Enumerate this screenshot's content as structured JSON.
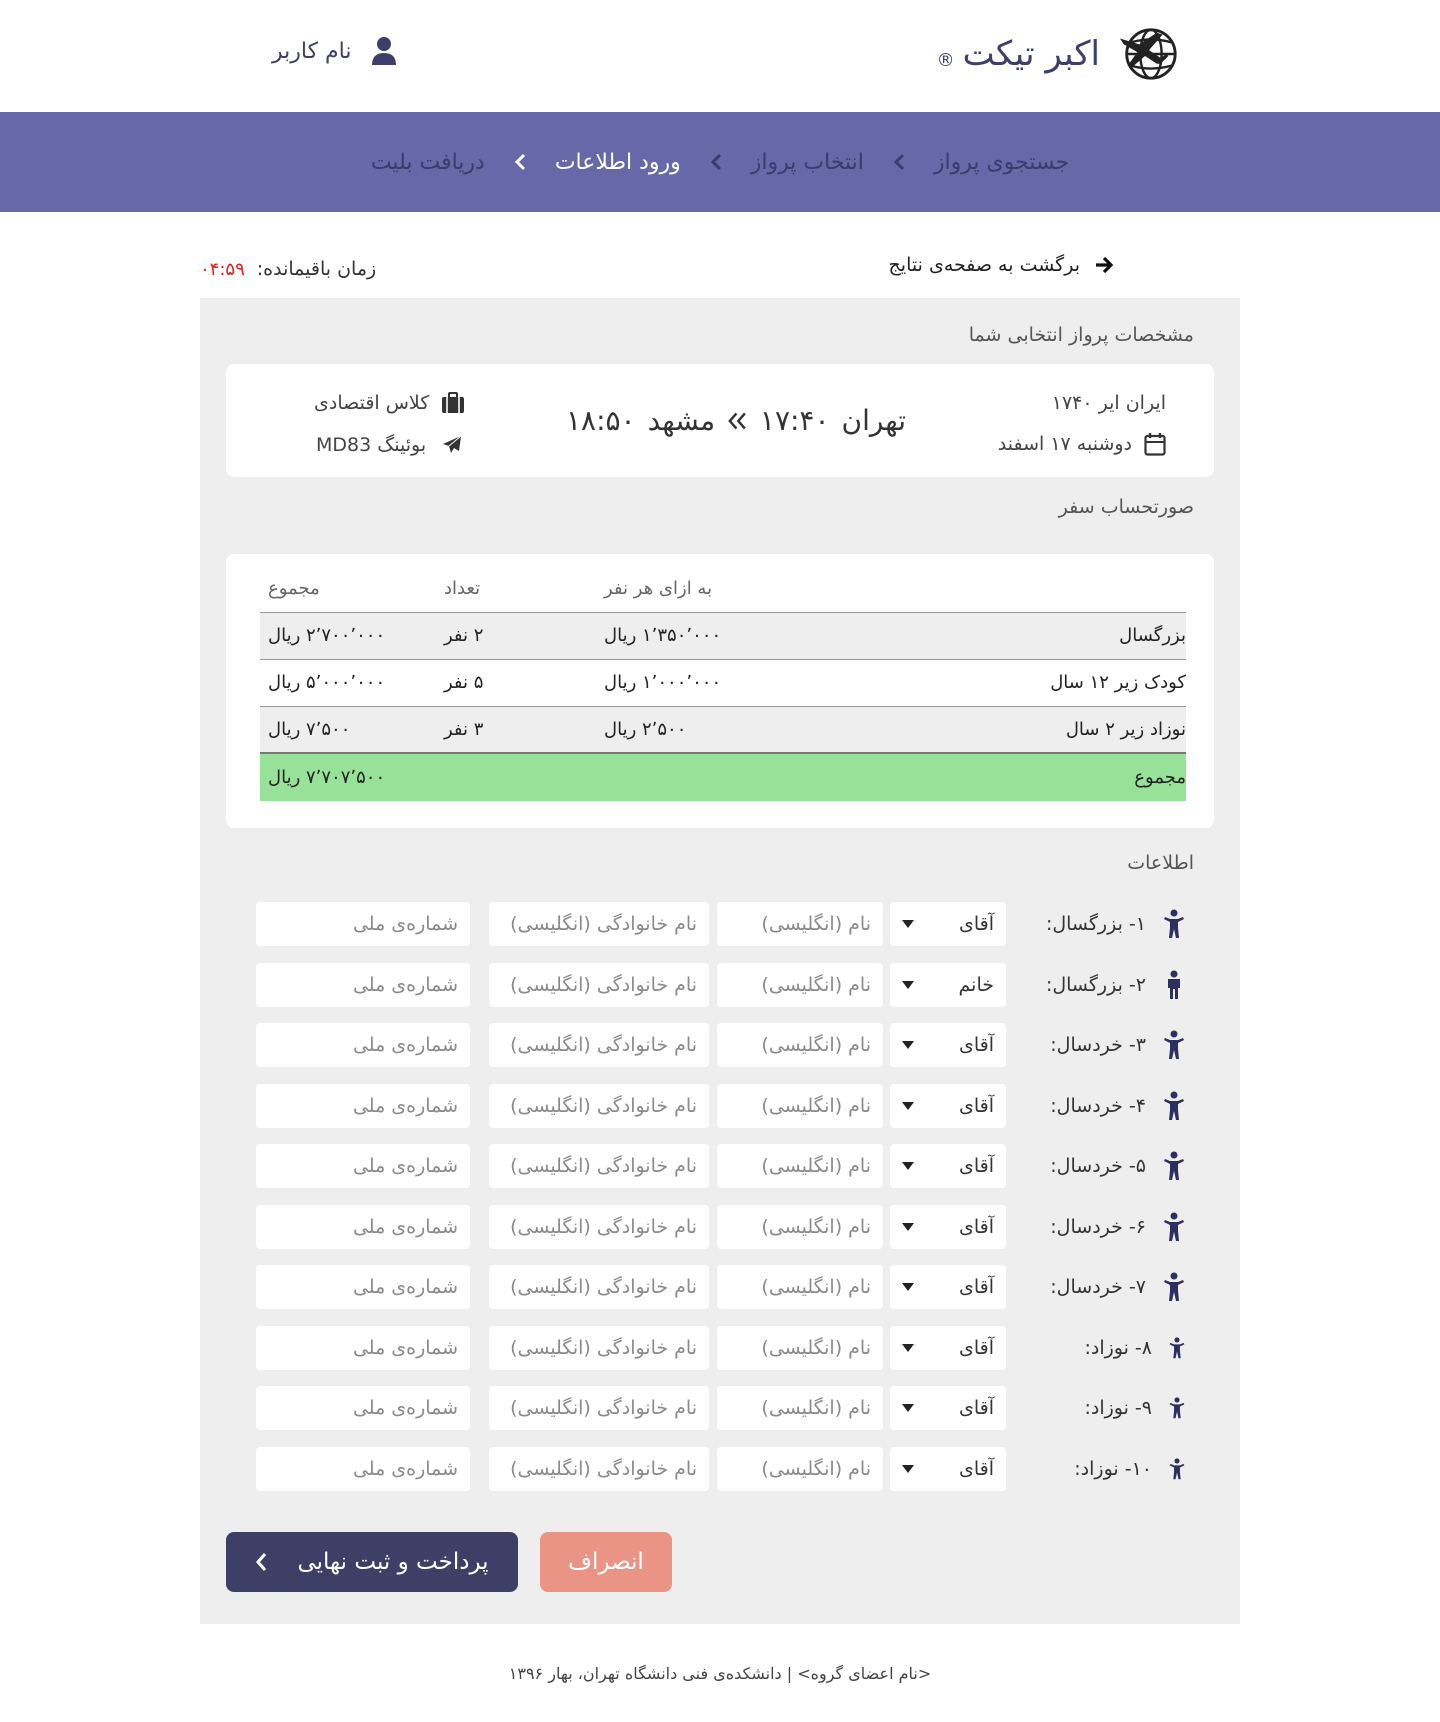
{
  "header": {
    "brand": "اکبر تیکت",
    "registered_mark": "®",
    "username": "نام کاربر",
    "logo_icon": "globe-plane-icon",
    "user_icon": "user-icon"
  },
  "steps": {
    "items": [
      {
        "label": "جستجوی پرواز",
        "active": false
      },
      {
        "label": "انتخاب پرواز",
        "active": false
      },
      {
        "label": "ورود اطلاعات",
        "active": true
      },
      {
        "label": "دریافت بلیت",
        "active": false
      }
    ],
    "bar_color": "#6668a8"
  },
  "nav": {
    "back_label": "برگشت به صفحه‌ی نتایج",
    "timer_label": "زمان باقیمانده:",
    "timer_value": "۰۴:۵۹"
  },
  "flight": {
    "section_title": "مشخصات پرواز انتخابی شما",
    "airline": "ایران ایر ۱۷۴۰",
    "date": "دوشنبه ۱۷ اسفند",
    "origin": "تهران",
    "departure_time": "۱۷:۴۰",
    "destination": "مشهد",
    "arrival_time": "۱۸:۵۰",
    "class": "کلاس اقتصادی",
    "aircraft": "بوئینگ MD83"
  },
  "invoice": {
    "section_title": "صورتحساب سفر",
    "headers": {
      "per_person": "به ازای هر نفر",
      "count": "تعداد",
      "total": "مجموع"
    },
    "rows": [
      {
        "label": "بزرگسال",
        "per_person": "۱٬۳۵۰٬۰۰۰ ریال",
        "count": "۲ نفر",
        "total": "۲٬۷۰۰٬۰۰۰ ریال"
      },
      {
        "label": "کودک زیر ۱۲ سال",
        "per_person": "۱٬۰۰۰٬۰۰۰ ریال",
        "count": "۵ نفر",
        "total": "۵٬۰۰۰٬۰۰۰ ریال"
      },
      {
        "label": "نوزاد زیر ۲ سال",
        "per_person": "۲٬۵۰۰ ریال",
        "count": "۳ نفر",
        "total": "۷٬۵۰۰ ریال"
      }
    ],
    "grand_total_label": "مجموع",
    "grand_total": "۷٬۷۰۷٬۵۰۰ ریال",
    "total_color": "#98e198"
  },
  "passengers": {
    "section_title": "اطلاعات",
    "placeholders": {
      "first_name": "نام (انگلیسی)",
      "last_name": "نام خانوادگی (انگلیسی)",
      "national_id": "شماره‌ی ملی"
    },
    "list": [
      {
        "label": "۱- بزرگسال:",
        "gender": "آقای",
        "type": "adult"
      },
      {
        "label": "۲- بزرگسال:",
        "gender": "خانم",
        "type": "adult-female"
      },
      {
        "label": "۳- خردسال:",
        "gender": "آقای",
        "type": "child"
      },
      {
        "label": "۴- خردسال:",
        "gender": "آقای",
        "type": "child"
      },
      {
        "label": "۵- خردسال:",
        "gender": "آقای",
        "type": "child"
      },
      {
        "label": "۶- خردسال:",
        "gender": "آقای",
        "type": "child"
      },
      {
        "label": "۷- خردسال:",
        "gender": "آقای",
        "type": "child"
      },
      {
        "label": "۸- نوزاد:",
        "gender": "آقای",
        "type": "infant"
      },
      {
        "label": "۹- نوزاد:",
        "gender": "آقای",
        "type": "infant"
      },
      {
        "label": "۱۰- نوزاد:",
        "gender": "آقای",
        "type": "infant"
      }
    ]
  },
  "actions": {
    "pay_label": "پرداخت و ثبت نهایی",
    "cancel_label": "انصراف",
    "pay_color": "#3d3f67",
    "cancel_color": "#ea9485"
  },
  "footer": {
    "text": "<نام اعضای گروه> | دانشکده‌ی فنی دانشگاه تهران، بهار ۱۳۹۶"
  }
}
